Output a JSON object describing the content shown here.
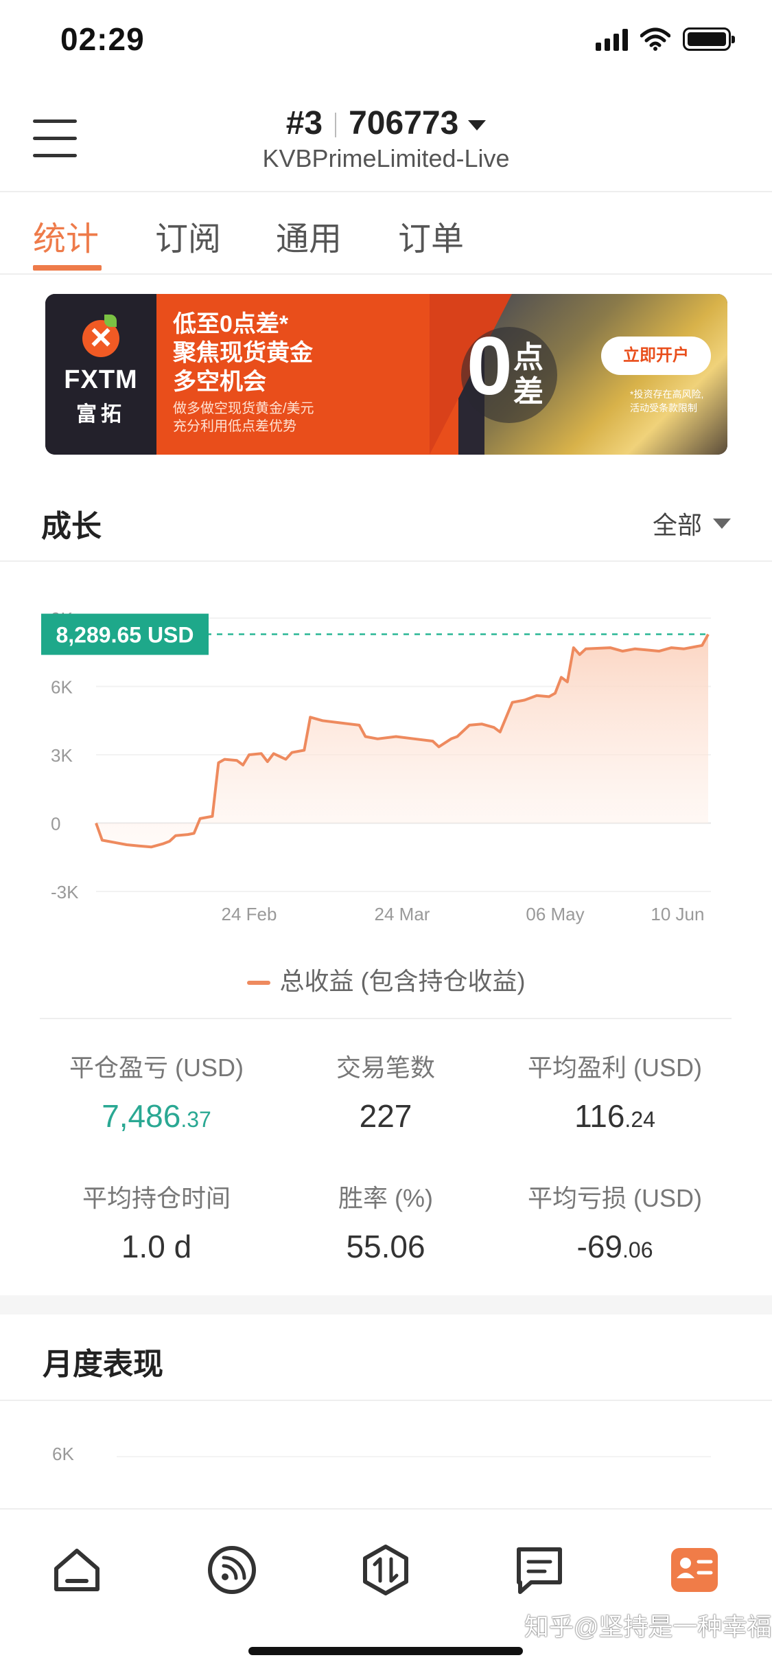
{
  "status_bar": {
    "time": "02:29"
  },
  "header": {
    "account_number": "#3",
    "account_id": "706773",
    "server": "KVBPrimeLimited-Live"
  },
  "tabs": [
    {
      "label": "统计",
      "active": true
    },
    {
      "label": "订阅",
      "active": false
    },
    {
      "label": "通用",
      "active": false
    },
    {
      "label": "订单",
      "active": false
    }
  ],
  "banner": {
    "brand": "FXTM",
    "brand_cn": "富拓",
    "line1": "低至0点差*",
    "line2": "聚焦现货黄金",
    "line3": "多空机会",
    "line4": "做多做空现货黄金/美元",
    "line5": "充分利用低点差优势",
    "zero": "0",
    "zero_dian": "点",
    "zero_cha": "差",
    "cta": "立即开户",
    "risk1": "*投资存在高风险,",
    "risk2": "活动受条款限制"
  },
  "growth": {
    "title": "成长",
    "filter": "全部",
    "legend": "总收益 (包含持仓收益)"
  },
  "chart_data": {
    "type": "area",
    "current_label": "8,289.65 USD",
    "current_value": 8289.65,
    "y_ticks": [
      "9K",
      "6K",
      "3K",
      "0",
      "-3K"
    ],
    "y_tick_values": [
      9000,
      6000,
      3000,
      0,
      -3000
    ],
    "ylim": [
      -3000,
      9000
    ],
    "x_ticks": [
      {
        "label": "24 Feb",
        "t": 0.25
      },
      {
        "label": "24 Mar",
        "t": 0.5
      },
      {
        "label": "06 May",
        "t": 0.75
      },
      {
        "label": "10 Jun",
        "t": 0.95
      }
    ],
    "series": [
      {
        "values": [
          [
            0.0,
            0
          ],
          [
            0.01,
            -750
          ],
          [
            0.03,
            -850
          ],
          [
            0.05,
            -950
          ],
          [
            0.07,
            -1000
          ],
          [
            0.09,
            -1050
          ],
          [
            0.11,
            -900
          ],
          [
            0.12,
            -800
          ],
          [
            0.13,
            -550
          ],
          [
            0.15,
            -500
          ],
          [
            0.16,
            -450
          ],
          [
            0.17,
            200
          ],
          [
            0.19,
            300
          ],
          [
            0.2,
            2650
          ],
          [
            0.21,
            2800
          ],
          [
            0.23,
            2750
          ],
          [
            0.24,
            2550
          ],
          [
            0.25,
            3000
          ],
          [
            0.27,
            3050
          ],
          [
            0.28,
            2700
          ],
          [
            0.29,
            3050
          ],
          [
            0.31,
            2800
          ],
          [
            0.32,
            3100
          ],
          [
            0.34,
            3200
          ],
          [
            0.35,
            4650
          ],
          [
            0.37,
            4500
          ],
          [
            0.4,
            4400
          ],
          [
            0.43,
            4300
          ],
          [
            0.44,
            3800
          ],
          [
            0.46,
            3700
          ],
          [
            0.49,
            3800
          ],
          [
            0.52,
            3700
          ],
          [
            0.55,
            3600
          ],
          [
            0.56,
            3350
          ],
          [
            0.58,
            3700
          ],
          [
            0.59,
            3800
          ],
          [
            0.61,
            4300
          ],
          [
            0.63,
            4350
          ],
          [
            0.65,
            4200
          ],
          [
            0.66,
            4000
          ],
          [
            0.68,
            5300
          ],
          [
            0.7,
            5400
          ],
          [
            0.72,
            5600
          ],
          [
            0.74,
            5550
          ],
          [
            0.75,
            5700
          ],
          [
            0.76,
            6400
          ],
          [
            0.77,
            6200
          ],
          [
            0.78,
            7700
          ],
          [
            0.79,
            7400
          ],
          [
            0.8,
            7650
          ],
          [
            0.84,
            7700
          ],
          [
            0.86,
            7550
          ],
          [
            0.88,
            7650
          ],
          [
            0.9,
            7600
          ],
          [
            0.92,
            7550
          ],
          [
            0.94,
            7700
          ],
          [
            0.96,
            7650
          ],
          [
            0.99,
            7800
          ],
          [
            1.0,
            8289.65
          ]
        ]
      }
    ],
    "colors": {
      "line": "#ee8a5e",
      "fill_top": "#fbd9c8",
      "fill_bottom": "#fff4ee",
      "label_bg": "#1ea88a",
      "dashed": "#2ab795"
    }
  },
  "stats": [
    {
      "label": "平仓盈亏 (USD)",
      "value_int": "7,486",
      "value_dec": ".37",
      "green": true
    },
    {
      "label": "交易笔数",
      "value_int": "227",
      "value_dec": "",
      "green": false
    },
    {
      "label": "平均盈利 (USD)",
      "value_int": "116",
      "value_dec": ".24",
      "green": false
    },
    {
      "label": "平均持仓时间",
      "value_int": "1.0 d",
      "value_dec": "",
      "green": false
    },
    {
      "label": "胜率 (%)",
      "value_int": "55.06",
      "value_dec": "",
      "green": false
    },
    {
      "label": "平均亏损 (USD)",
      "value_int": "-69",
      "value_dec": ".06",
      "green": false
    }
  ],
  "monthly": {
    "title": "月度表现",
    "y_tick": "6K"
  },
  "bottom_nav": [
    {
      "icon": "home-icon",
      "active": false
    },
    {
      "icon": "signal-feed-icon",
      "active": false
    },
    {
      "icon": "trade-icon",
      "active": false
    },
    {
      "icon": "chat-icon",
      "active": false
    },
    {
      "icon": "profile-card-icon",
      "active": true
    }
  ],
  "watermark": "知乎@坚持是一种幸福"
}
